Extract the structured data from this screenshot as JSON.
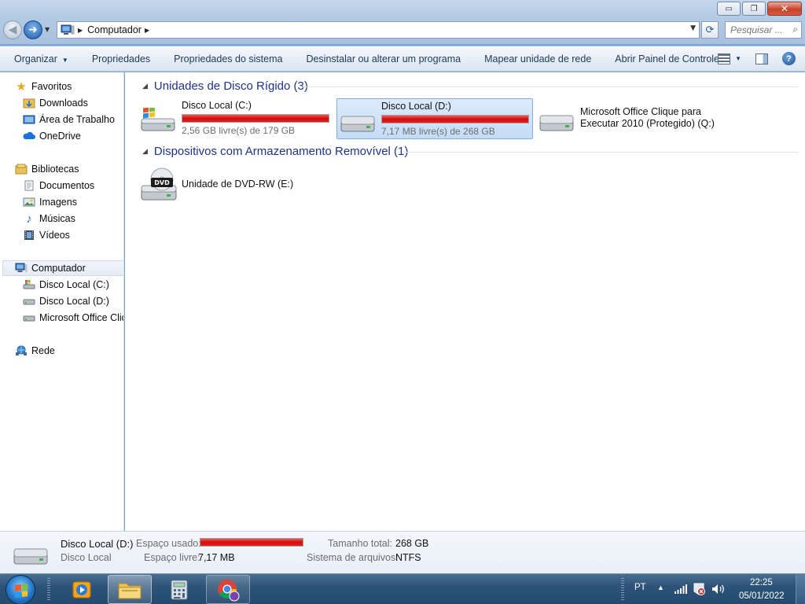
{
  "window": {
    "caption_buttons": {
      "minimize": "▭",
      "maximize": "❐",
      "close": "✕"
    }
  },
  "address": {
    "path": "Computador",
    "search_placeholder": "Pesquisar ..."
  },
  "toolbar": {
    "organize": "Organizar",
    "properties": "Propriedades",
    "system_properties": "Propriedades do sistema",
    "uninstall": "Desinstalar ou alterar um programa",
    "map_drive": "Mapear unidade de rede",
    "control_panel": "Abrir Painel de Controle",
    "help": "?"
  },
  "nav": {
    "favorites": "Favoritos",
    "downloads": "Downloads",
    "desktop": "Área de Trabalho",
    "onedrive": "OneDrive",
    "libraries": "Bibliotecas",
    "documents": "Documentos",
    "images": "Imagens",
    "music": "Músicas",
    "videos": "Vídeos",
    "computer": "Computador",
    "drive_c": "Disco Local (C:)",
    "drive_d": "Disco Local (D:)",
    "drive_q": "Microsoft Office Clique para Executar 2010 (Protegido) (Q:)",
    "network": "Rede"
  },
  "content": {
    "hard_disks_header": "Unidades de Disco Rígido (3)",
    "removable_header": "Dispositivos com Armazenamento Removível (1)",
    "drives": [
      {
        "name": "Disco Local (C:)",
        "info": "2,56 GB livre(s) de 179 GB",
        "used_fraction": 0.986
      },
      {
        "name": "Disco Local (D:)",
        "info": "7,17 MB livre(s) de 268 GB",
        "used_fraction": 1.0
      },
      {
        "name": "Microsoft Office Clique para Executar 2010 (Protegido) (Q:)"
      }
    ],
    "dvd": {
      "name": "Unidade de DVD-RW (E:)",
      "badge": "DVD"
    }
  },
  "details": {
    "name": "Disco Local (D:)",
    "type": "Disco Local",
    "used_label": "Espaço usado:",
    "used_fraction": 1.0,
    "free_label": "Espaço livre:",
    "free_value": "7,17 MB",
    "total_label": "Tamanho total:",
    "total_value": "268 GB",
    "fs_label": "Sistema de arquivos:",
    "fs_value": "NTFS"
  },
  "taskbar": {
    "language": "PT",
    "time": "22:25",
    "date": "05/01/2022"
  },
  "colors": {
    "usage_bar": "#d20b0b",
    "group_header": "#1e3287",
    "selection": "#c4dcf6"
  }
}
